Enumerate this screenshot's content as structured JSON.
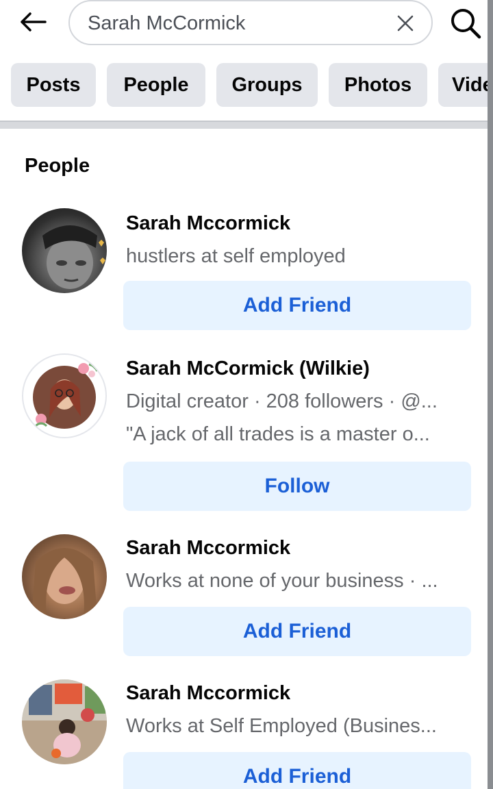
{
  "search": {
    "query": "Sarah McCormick",
    "back_icon": "arrow-left-icon",
    "clear_icon": "close-icon",
    "search_icon": "search-icon"
  },
  "tabs": [
    {
      "label": "Posts"
    },
    {
      "label": "People"
    },
    {
      "label": "Groups"
    },
    {
      "label": "Photos"
    },
    {
      "label": "Vide"
    }
  ],
  "section": {
    "title": "People"
  },
  "results": [
    {
      "name": "Sarah Mccormick",
      "line1": "hustlers at self employed",
      "line2": "",
      "action": "Add Friend"
    },
    {
      "name": "Sarah McCormick (Wilkie)",
      "line1": "Digital creator · 208 followers · @...",
      "line2": "\"A jack of all trades is a master o...",
      "action": "Follow"
    },
    {
      "name": "Sarah Mccormick",
      "line1": "Works at none of your business · ...",
      "line2": "",
      "action": "Add Friend"
    },
    {
      "name": "Sarah Mccormick",
      "line1": "Works at Self Employed (Busines...",
      "line2": "",
      "action": "Add Friend"
    }
  ],
  "colors": {
    "accent": "#1b5fd6",
    "button_bg": "#e7f3ff",
    "tab_bg": "#e4e6eb",
    "secondary_text": "#65676b"
  }
}
